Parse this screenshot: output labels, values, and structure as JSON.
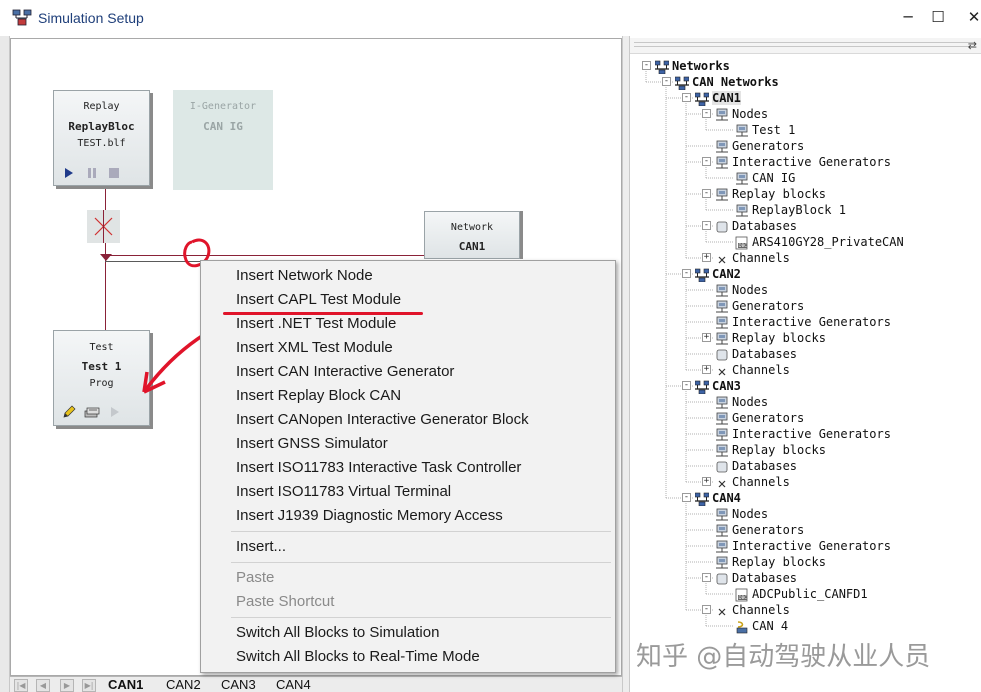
{
  "window": {
    "title": "Simulation Setup",
    "minimize": "─",
    "maximize": "☐",
    "close": "✕"
  },
  "canvas": {
    "replay_block": {
      "line1": "Replay",
      "line2": "ReplayBloc",
      "line3": "TEST.blf"
    },
    "ig_block": {
      "line1": "I-Generator",
      "line2": "CAN IG"
    },
    "network_block": {
      "line1": "Network",
      "line2": "CAN1"
    },
    "test_block": {
      "line1": "Test",
      "line2": "Test 1",
      "line3": "Prog"
    },
    "wire_color": "#8a2238",
    "annotation_color": "#e0142a"
  },
  "tabs": [
    "CAN1",
    "CAN2",
    "CAN3",
    "CAN4"
  ],
  "context_menu": {
    "group1": [
      "Insert Network Node",
      "Insert CAPL Test Module",
      "Insert .NET Test Module",
      "Insert XML Test Module",
      "Insert CAN Interactive Generator",
      "Insert Replay Block CAN",
      "Insert CANopen Interactive Generator Block",
      "Insert GNSS Simulator",
      "Insert ISO11783 Interactive Task Controller",
      "Insert ISO11783 Virtual Terminal",
      "Insert J1939 Diagnostic Memory Access"
    ],
    "insert_more": "Insert...",
    "paste": "Paste",
    "paste_shortcut": "Paste Shortcut",
    "switch_sim": "Switch All Blocks to Simulation",
    "switch_rt": "Switch All Blocks to Real-Time Mode"
  },
  "tree": [
    {
      "label": "Networks",
      "level": 0,
      "icon": "network-icon",
      "exp": "-",
      "bold": true
    },
    {
      "label": "CAN Networks",
      "level": 1,
      "icon": "network-icon",
      "exp": "-",
      "bold": true
    },
    {
      "label": "CAN1",
      "level": 2,
      "icon": "network-icon",
      "exp": "-",
      "bold": true,
      "selected": true
    },
    {
      "label": "Nodes",
      "level": 3,
      "icon": "node-icon",
      "exp": "-"
    },
    {
      "label": "Test 1",
      "level": 4,
      "icon": "node-icon",
      "exp": ""
    },
    {
      "label": "Generators",
      "level": 3,
      "icon": "node-icon",
      "exp": ""
    },
    {
      "label": "Interactive Generators",
      "level": 3,
      "icon": "node-icon",
      "exp": "-"
    },
    {
      "label": "CAN IG",
      "level": 4,
      "icon": "node-icon",
      "exp": ""
    },
    {
      "label": "Replay blocks",
      "level": 3,
      "icon": "node-icon",
      "exp": "-"
    },
    {
      "label": "ReplayBlock 1",
      "level": 4,
      "icon": "node-icon",
      "exp": ""
    },
    {
      "label": "Databases",
      "level": 3,
      "icon": "database-icon",
      "exp": "-"
    },
    {
      "label": "ARS410GY28_PrivateCAN",
      "level": 4,
      "icon": "dbc-file-icon",
      "exp": ""
    },
    {
      "label": "Channels",
      "level": 3,
      "icon": "channel-icon",
      "exp": "+"
    },
    {
      "label": "CAN2",
      "level": 2,
      "icon": "network-icon",
      "exp": "-",
      "bold": true
    },
    {
      "label": "Nodes",
      "level": 3,
      "icon": "node-icon",
      "exp": ""
    },
    {
      "label": "Generators",
      "level": 3,
      "icon": "node-icon",
      "exp": ""
    },
    {
      "label": "Interactive Generators",
      "level": 3,
      "icon": "node-icon",
      "exp": ""
    },
    {
      "label": "Replay blocks",
      "level": 3,
      "icon": "node-icon",
      "exp": "+"
    },
    {
      "label": "Databases",
      "level": 3,
      "icon": "database-icon",
      "exp": ""
    },
    {
      "label": "Channels",
      "level": 3,
      "icon": "channel-icon",
      "exp": "+"
    },
    {
      "label": "CAN3",
      "level": 2,
      "icon": "network-icon",
      "exp": "-",
      "bold": true
    },
    {
      "label": "Nodes",
      "level": 3,
      "icon": "node-icon",
      "exp": ""
    },
    {
      "label": "Generators",
      "level": 3,
      "icon": "node-icon",
      "exp": ""
    },
    {
      "label": "Interactive Generators",
      "level": 3,
      "icon": "node-icon",
      "exp": ""
    },
    {
      "label": "Replay blocks",
      "level": 3,
      "icon": "node-icon",
      "exp": ""
    },
    {
      "label": "Databases",
      "level": 3,
      "icon": "database-icon",
      "exp": ""
    },
    {
      "label": "Channels",
      "level": 3,
      "icon": "channel-icon",
      "exp": "+"
    },
    {
      "label": "CAN4",
      "level": 2,
      "icon": "network-icon",
      "exp": "-",
      "bold": true
    },
    {
      "label": "Nodes",
      "level": 3,
      "icon": "node-icon",
      "exp": ""
    },
    {
      "label": "Generators",
      "level": 3,
      "icon": "node-icon",
      "exp": ""
    },
    {
      "label": "Interactive Generators",
      "level": 3,
      "icon": "node-icon",
      "exp": ""
    },
    {
      "label": "Replay blocks",
      "level": 3,
      "icon": "node-icon",
      "exp": ""
    },
    {
      "label": "Databases",
      "level": 3,
      "icon": "database-icon",
      "exp": "-"
    },
    {
      "label": "ADCPublic_CANFD1",
      "level": 4,
      "icon": "dbc-file-icon",
      "exp": ""
    },
    {
      "label": "Channels",
      "level": 3,
      "icon": "channel-icon",
      "exp": "-"
    },
    {
      "label": "CAN 4",
      "level": 4,
      "icon": "can-channel-icon",
      "exp": ""
    }
  ],
  "watermark": "知乎 @自动驾驶从业人员"
}
